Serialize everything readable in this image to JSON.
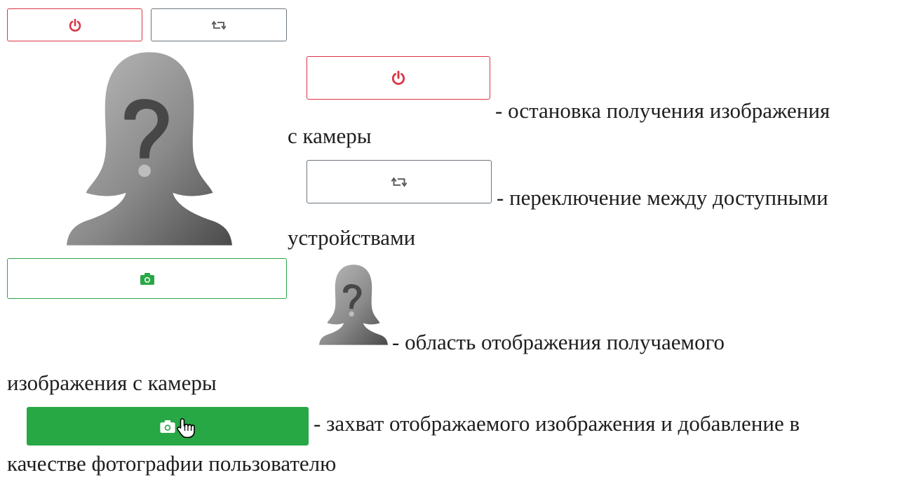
{
  "widget": {
    "stop_button": {
      "icon": "power-icon",
      "color": "#dc3545"
    },
    "switch_button": {
      "icon": "repeat-icon",
      "color": "#6c757d"
    },
    "preview": {
      "icon": "unknown-person-silhouette"
    },
    "capture_outline_button": {
      "icon": "camera-icon",
      "color": "#28a745"
    }
  },
  "legend": {
    "stop_line1": "- остановка получения изображения",
    "stop_line2": "с камеры",
    "switch_line1": "- переключение между доступными",
    "switch_line2": "устройствами",
    "preview_line1": "- область отображения получаемого",
    "preview_line2": "изображения с камеры",
    "capture_line1": "- захват отображаемого изображения и добавление в",
    "capture_line2": "качестве фотографии пользователю",
    "capture_button": {
      "icon": "camera-icon",
      "cursor": "hand-pointer-cursor",
      "color": "#28a745"
    }
  }
}
